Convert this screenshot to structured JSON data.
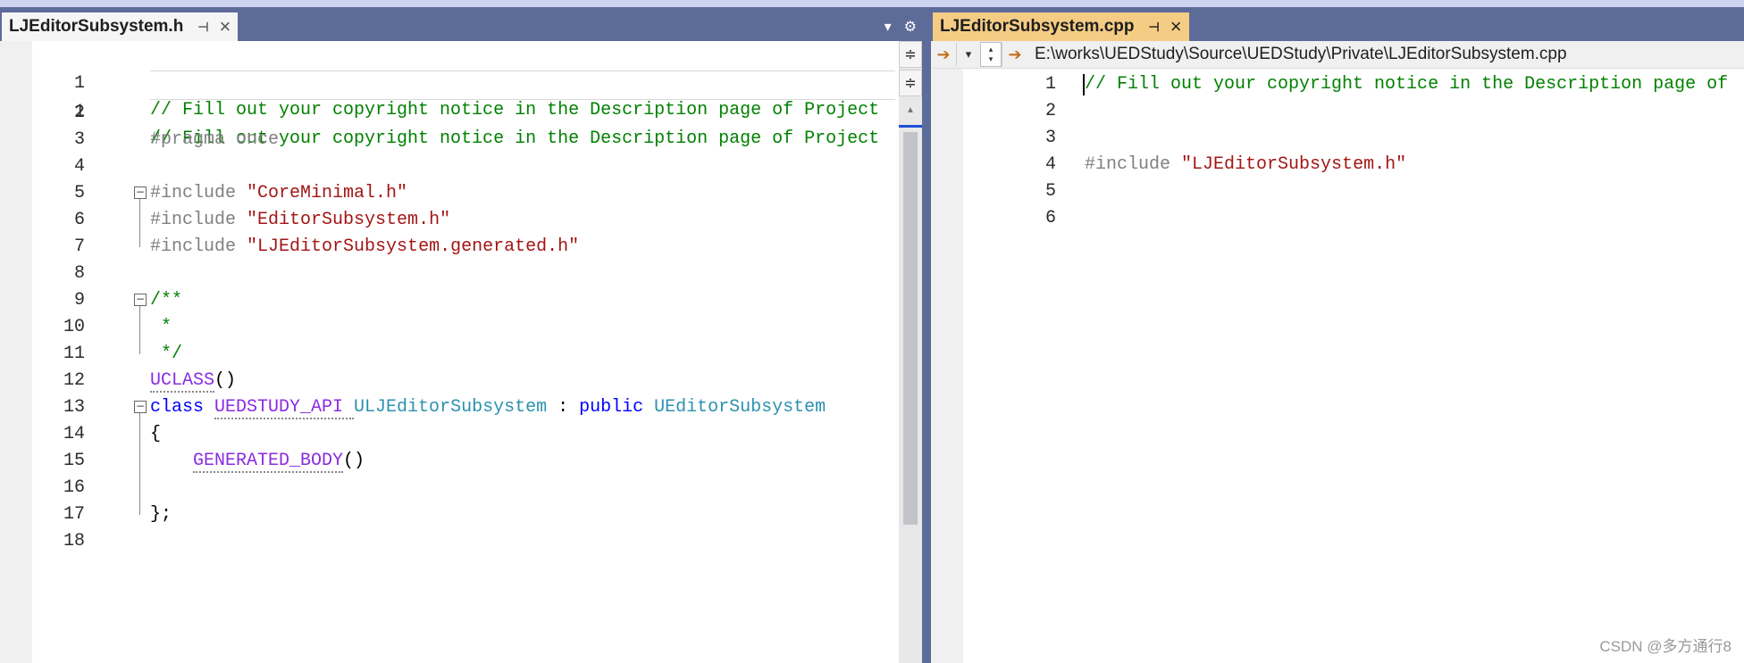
{
  "left_tab": {
    "title": "LJEditorSubsystem.h",
    "pin_icon": "pin-icon",
    "close_icon": "close-icon"
  },
  "left_tools": {
    "dropdown": "▾",
    "settings": "⚙"
  },
  "right_tab": {
    "title": "LJEditorSubsystem.cpp",
    "pin_icon": "pin-icon",
    "close_icon": "close-icon"
  },
  "right_nav": {
    "path": "E:\\works\\UEDStudy\\Source\\UEDStudy\\Private\\LJEditorSubsystem.cpp"
  },
  "left_code": {
    "peek1": {
      "ln": "1",
      "text": "// Fill out your copyright notice in the Description page of Project"
    },
    "peek2": {
      "ln": "1",
      "text": "// Fill out your copyright notice in the Description page of Project"
    },
    "lines": [
      {
        "ln": "2"
      },
      {
        "ln": "3",
        "text": "#pragma once"
      },
      {
        "ln": "4"
      },
      {
        "ln": "5",
        "pp": "#include ",
        "str": "\"CoreMinimal.h\""
      },
      {
        "ln": "6",
        "pp": "#include ",
        "str": "\"EditorSubsystem.h\""
      },
      {
        "ln": "7",
        "pp": "#include ",
        "str": "\"LJEditorSubsystem.generated.h\""
      },
      {
        "ln": "8"
      },
      {
        "ln": "9",
        "text": "/**"
      },
      {
        "ln": "10",
        "text": " *"
      },
      {
        "ln": "11",
        "text": " */"
      },
      {
        "ln": "12",
        "mac": "UCLASS",
        "rest": "()"
      },
      {
        "ln": "13",
        "kw": "class ",
        "mac": "UEDSTUDY_API ",
        "typ": "ULJEditorSubsystem",
        "sep": " : ",
        "kw2": "public ",
        "typ2": "UEditorSubsystem"
      },
      {
        "ln": "14",
        "text": "{"
      },
      {
        "ln": "15",
        "mac": "GENERATED_BODY",
        "rest": "()"
      },
      {
        "ln": "16"
      },
      {
        "ln": "17",
        "text": "};"
      },
      {
        "ln": "18"
      }
    ]
  },
  "right_code": {
    "lines": [
      {
        "ln": "1",
        "text": "// Fill out your copyright notice in the Description page of"
      },
      {
        "ln": "2"
      },
      {
        "ln": "3"
      },
      {
        "ln": "4",
        "pp": "#include ",
        "str": "\"LJEditorSubsystem.h\""
      },
      {
        "ln": "5"
      },
      {
        "ln": "6"
      }
    ]
  },
  "watermark": "CSDN @多方通行8",
  "colors": {
    "comment": "#008000",
    "string": "#a31515",
    "keyword": "#0000ff",
    "macro": "#8a2be2",
    "type": "#2b91af",
    "preprocessor": "#808080",
    "active_tab": "#f5cc84",
    "frame": "#5d6b99"
  }
}
